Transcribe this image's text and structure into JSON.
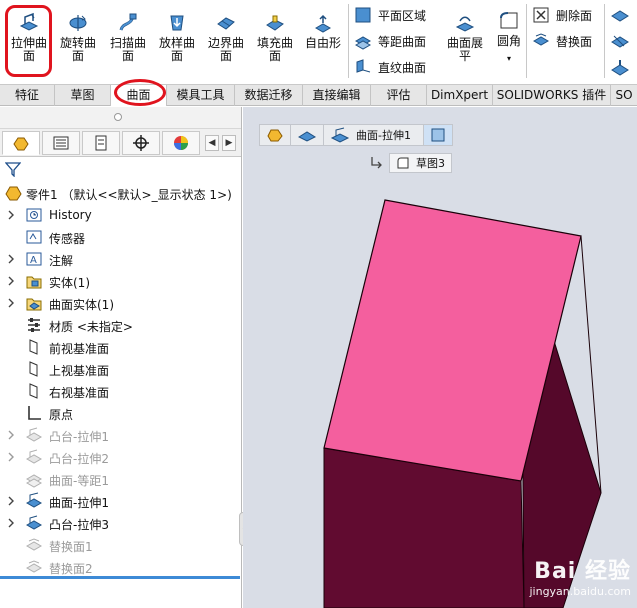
{
  "ribbon": {
    "buttons": [
      {
        "label": "拉伸曲\n面"
      },
      {
        "label": "旋转曲\n面"
      },
      {
        "label": "扫描曲\n面"
      },
      {
        "label": "放样曲\n面"
      },
      {
        "label": "边界曲\n面"
      },
      {
        "label": "填充曲\n面"
      },
      {
        "label": "自由形"
      }
    ],
    "small_buttons": [
      "平面区域",
      "等距曲面",
      "直纹曲面"
    ],
    "flatten": {
      "label": "曲面展\n平"
    },
    "fillet": {
      "label": "圆角"
    },
    "face_buttons": [
      "删除面",
      "替换面"
    ]
  },
  "tabs": [
    "特征",
    "草图",
    "曲面",
    "模具工具",
    "数据迁移",
    "直接编辑",
    "评估",
    "DimXpert",
    "SOLIDWORKS 插件",
    "SO"
  ],
  "active_tab": "曲面",
  "tree": {
    "root": "零件1 （默认<<默认>_显示状态 1>)",
    "items": [
      {
        "label": "History",
        "icon": "history-icon",
        "expandable": true,
        "grey": false
      },
      {
        "label": "传感器",
        "icon": "sensor-icon",
        "expandable": false,
        "grey": false
      },
      {
        "label": "注解",
        "icon": "annotation-icon",
        "expandable": true,
        "grey": false
      },
      {
        "label": "实体(1)",
        "icon": "solid-bodies-icon",
        "expandable": true,
        "grey": false
      },
      {
        "label": "曲面实体(1)",
        "icon": "surface-bodies-icon",
        "expandable": true,
        "grey": false
      },
      {
        "label": "材质 <未指定>",
        "icon": "material-icon",
        "expandable": false,
        "grey": false
      },
      {
        "label": "前视基准面",
        "icon": "plane-icon",
        "expandable": false,
        "grey": false
      },
      {
        "label": "上视基准面",
        "icon": "plane-icon",
        "expandable": false,
        "grey": false
      },
      {
        "label": "右视基准面",
        "icon": "plane-icon",
        "expandable": false,
        "grey": false
      },
      {
        "label": "原点",
        "icon": "origin-icon",
        "expandable": false,
        "grey": false
      },
      {
        "label": "凸台-拉伸1",
        "icon": "boss-extrude-icon",
        "expandable": true,
        "grey": true
      },
      {
        "label": "凸台-拉伸2",
        "icon": "boss-extrude-icon",
        "expandable": true,
        "grey": true
      },
      {
        "label": "曲面-等距1",
        "icon": "offset-surface-icon",
        "expandable": false,
        "grey": true
      },
      {
        "label": "曲面-拉伸1",
        "icon": "surface-extrude-icon",
        "expandable": true,
        "grey": false
      },
      {
        "label": "凸台-拉伸3",
        "icon": "boss-extrude-icon",
        "expandable": true,
        "grey": false
      },
      {
        "label": "替换面1",
        "icon": "replace-face-icon",
        "expandable": false,
        "grey": true
      },
      {
        "label": "替换面2",
        "icon": "replace-face-icon",
        "expandable": false,
        "grey": true
      }
    ]
  },
  "breadcrumb": {
    "feature": "曲面-拉伸1",
    "sketch": "草图3"
  },
  "watermark": {
    "brand": "Bai 经验",
    "url": "jingyan.baidu.com"
  },
  "colors": {
    "top_face": "#f45f9e",
    "side_dark": "#55082a",
    "side_front": "#610b30",
    "highlight": "#e0141e",
    "viewport_bg": "#d9dde6"
  }
}
